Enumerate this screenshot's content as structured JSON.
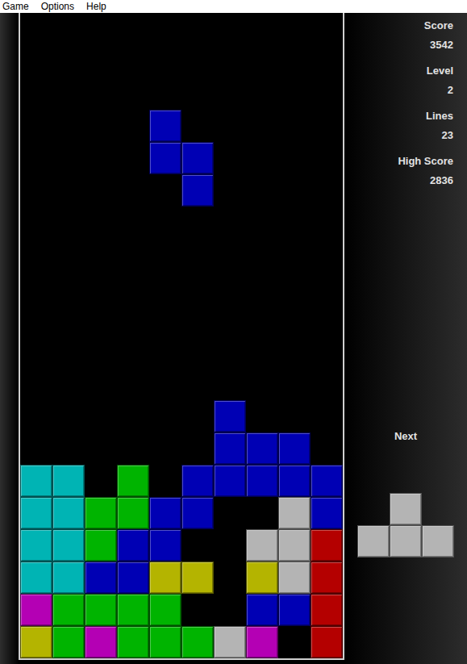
{
  "menu": [
    "Game",
    "Options",
    "Help"
  ],
  "stats": [
    {
      "label": "Score",
      "value": "3542"
    },
    {
      "label": "Level",
      "value": "2"
    },
    {
      "label": "Lines",
      "value": "23"
    },
    {
      "label": "High Score",
      "value": "2836"
    }
  ],
  "next": {
    "label": "Next",
    "cells": [
      [
        null,
        "#b4b4b4",
        null
      ],
      [
        "#b4b4b4",
        "#b4b4b4",
        "#b4b4b4"
      ]
    ]
  },
  "board": [
    [
      null,
      null,
      null,
      null,
      null,
      null,
      null,
      null,
      null,
      null
    ],
    [
      null,
      null,
      null,
      null,
      null,
      null,
      null,
      null,
      null,
      null
    ],
    [
      null,
      null,
      null,
      null,
      null,
      null,
      null,
      null,
      null,
      null
    ],
    [
      null,
      null,
      null,
      null,
      "#0000b4",
      null,
      null,
      null,
      null,
      null
    ],
    [
      null,
      null,
      null,
      null,
      "#0000b4",
      "#0000b4",
      null,
      null,
      null,
      null
    ],
    [
      null,
      null,
      null,
      null,
      null,
      "#0000b4",
      null,
      null,
      null,
      null
    ],
    [
      null,
      null,
      null,
      null,
      null,
      null,
      null,
      null,
      null,
      null
    ],
    [
      null,
      null,
      null,
      null,
      null,
      null,
      null,
      null,
      null,
      null
    ],
    [
      null,
      null,
      null,
      null,
      null,
      null,
      null,
      null,
      null,
      null
    ],
    [
      null,
      null,
      null,
      null,
      null,
      null,
      null,
      null,
      null,
      null
    ],
    [
      null,
      null,
      null,
      null,
      null,
      null,
      null,
      null,
      null,
      null
    ],
    [
      null,
      null,
      null,
      null,
      null,
      null,
      null,
      null,
      null,
      null
    ],
    [
      null,
      null,
      null,
      null,
      null,
      null,
      "#0000b4",
      null,
      null,
      null
    ],
    [
      null,
      null,
      null,
      null,
      null,
      null,
      "#0000b4",
      "#0000b4",
      "#0000b4",
      null
    ],
    [
      "#00b4b4",
      "#00b4b4",
      null,
      "#00b400",
      null,
      "#0000b4",
      "#0000b4",
      "#0000b4",
      "#0000b4",
      "#0000b4"
    ],
    [
      "#00b4b4",
      "#00b4b4",
      "#00b400",
      "#00b400",
      "#0000b4",
      "#0000b4",
      null,
      null,
      "#b4b4b4",
      "#0000b4"
    ],
    [
      "#00b4b4",
      "#00b4b4",
      "#00b400",
      "#0000b4",
      "#0000b4",
      null,
      null,
      "#b4b4b4",
      "#b4b4b4",
      "#b40000"
    ],
    [
      "#00b4b4",
      "#00b4b4",
      "#0000b4",
      "#0000b4",
      "#b4b400",
      "#b4b400",
      null,
      "#b4b400",
      "#b4b4b4",
      "#b40000"
    ],
    [
      "#b400b4",
      "#00b400",
      "#00b400",
      "#00b400",
      "#00b400",
      null,
      null,
      "#0000b4",
      "#0000b4",
      "#b40000"
    ],
    [
      "#b4b400",
      "#00b400",
      "#b400b4",
      "#00b400",
      "#00b400",
      "#00b400",
      "#b4b4b4",
      "#b400b4",
      null,
      "#b40000"
    ]
  ]
}
